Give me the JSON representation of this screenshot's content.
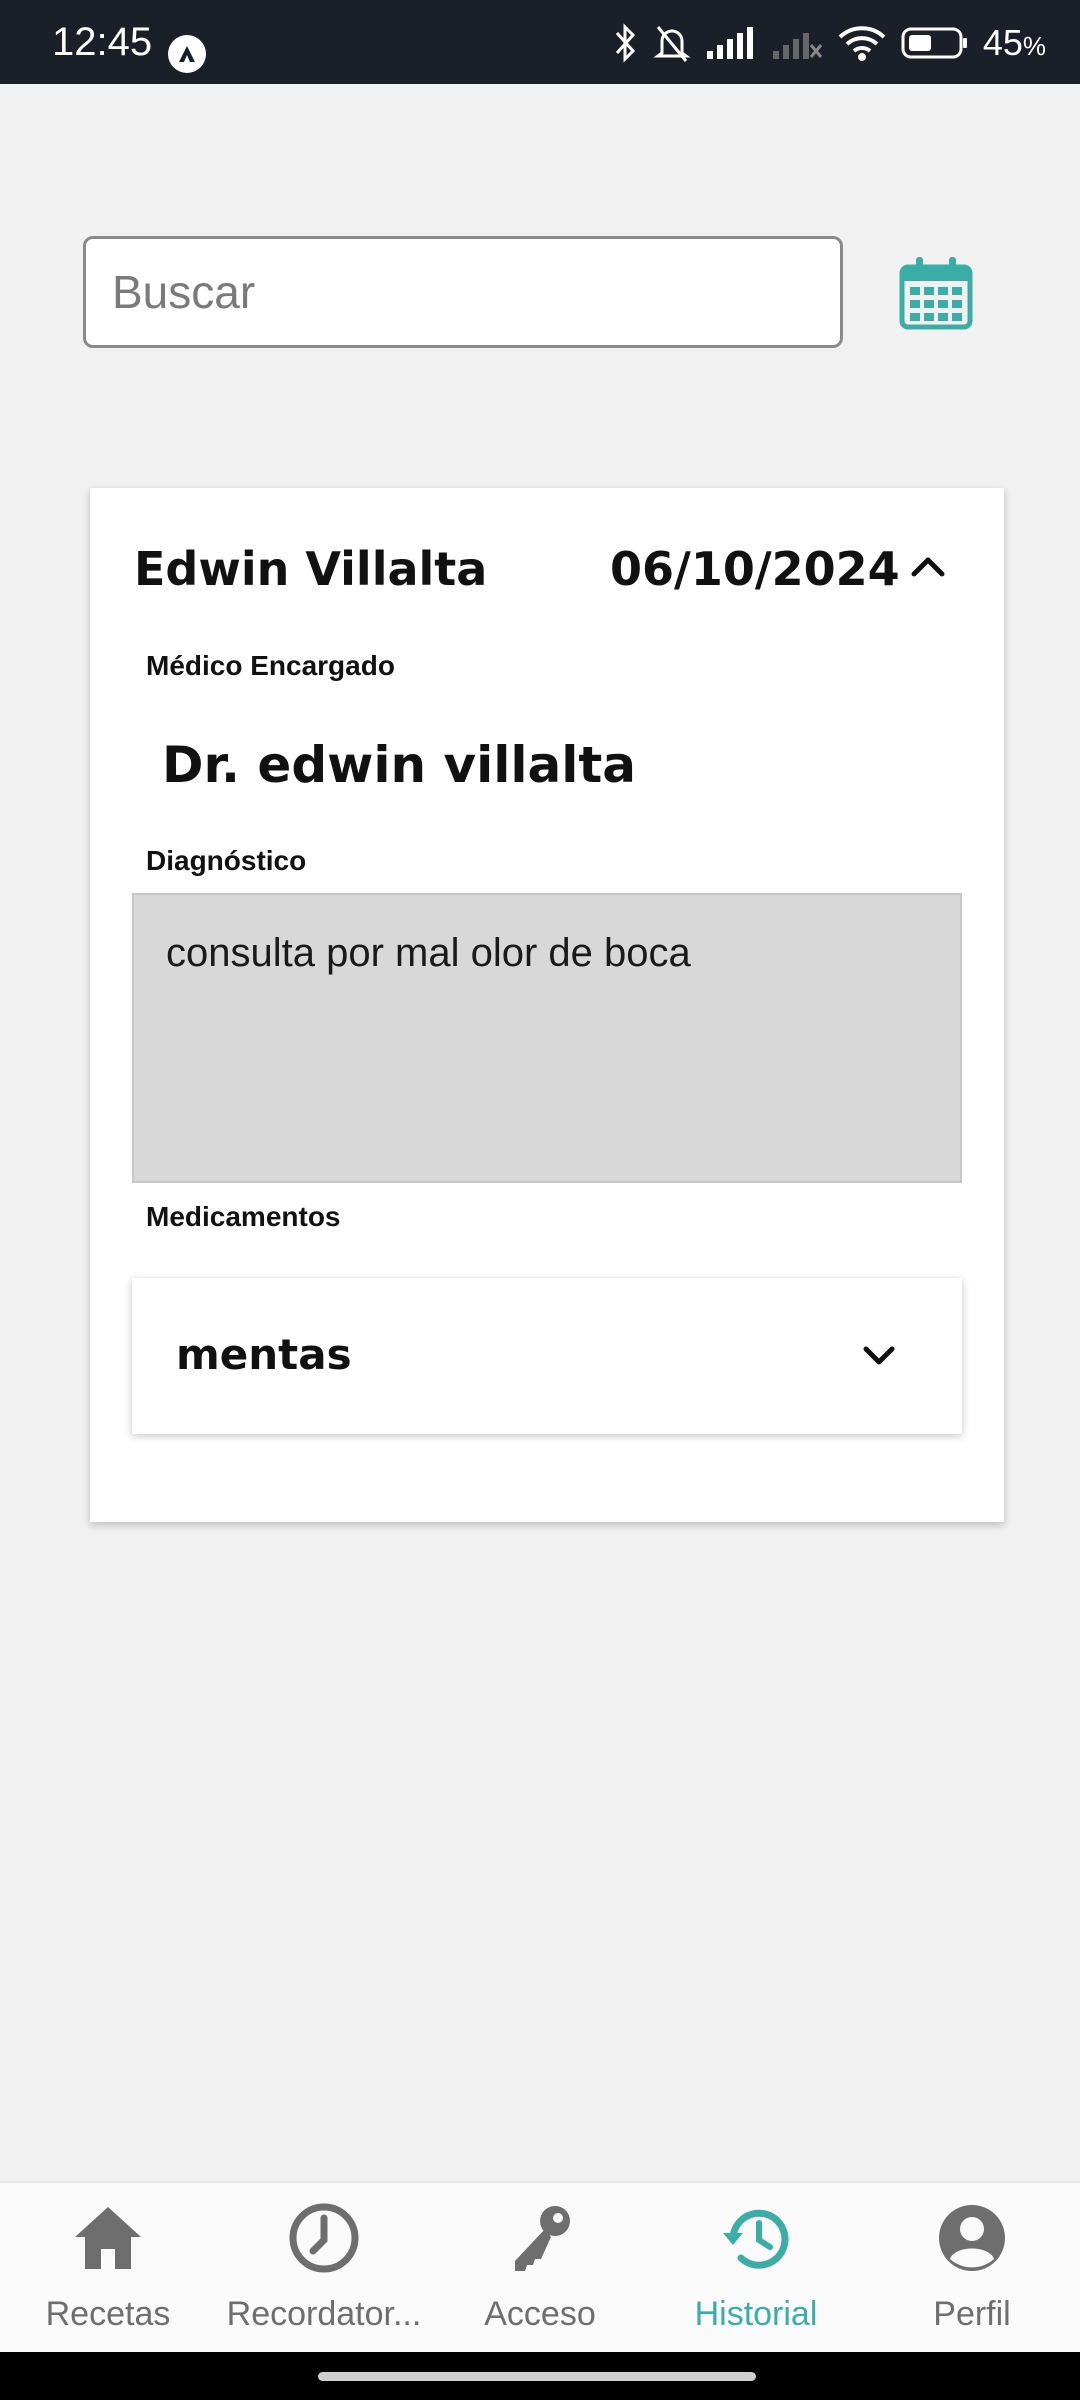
{
  "status_bar": {
    "time": "12:45",
    "battery_percent": "45",
    "battery_unit": "%",
    "icons": [
      "app-notification-icon",
      "bluetooth-icon",
      "bell-muted-icon",
      "signal-icon",
      "signal-no-service-icon",
      "wifi-icon",
      "battery-icon"
    ]
  },
  "search": {
    "placeholder": "Buscar",
    "value": ""
  },
  "calendar_icon": "calendar-icon",
  "record": {
    "patient_name": "Edwin Villalta",
    "date": "06/10/2024",
    "expanded": true,
    "doctor_label": "Médico Encargado",
    "doctor_name": "Dr. edwin villalta",
    "diagnosis_label": "Diagnóstico",
    "diagnosis_text": "consulta por mal olor de boca",
    "medications_label": "Medicamentos",
    "medications": [
      {
        "name": "mentas",
        "expanded": false
      }
    ]
  },
  "bottom_nav": {
    "items": [
      {
        "label": "Recetas",
        "icon": "home-icon",
        "active": false
      },
      {
        "label": "Recordator...",
        "icon": "clock-icon",
        "active": false
      },
      {
        "label": "Acceso",
        "icon": "key-icon",
        "active": false
      },
      {
        "label": "Historial",
        "icon": "history-icon",
        "active": true
      },
      {
        "label": "Perfil",
        "icon": "profile-icon",
        "active": false
      }
    ]
  },
  "colors": {
    "accent": "#3aaea6",
    "inactive": "#6e6e6e",
    "status_bar": "#1b1f27",
    "background": "#f1f1f1"
  }
}
